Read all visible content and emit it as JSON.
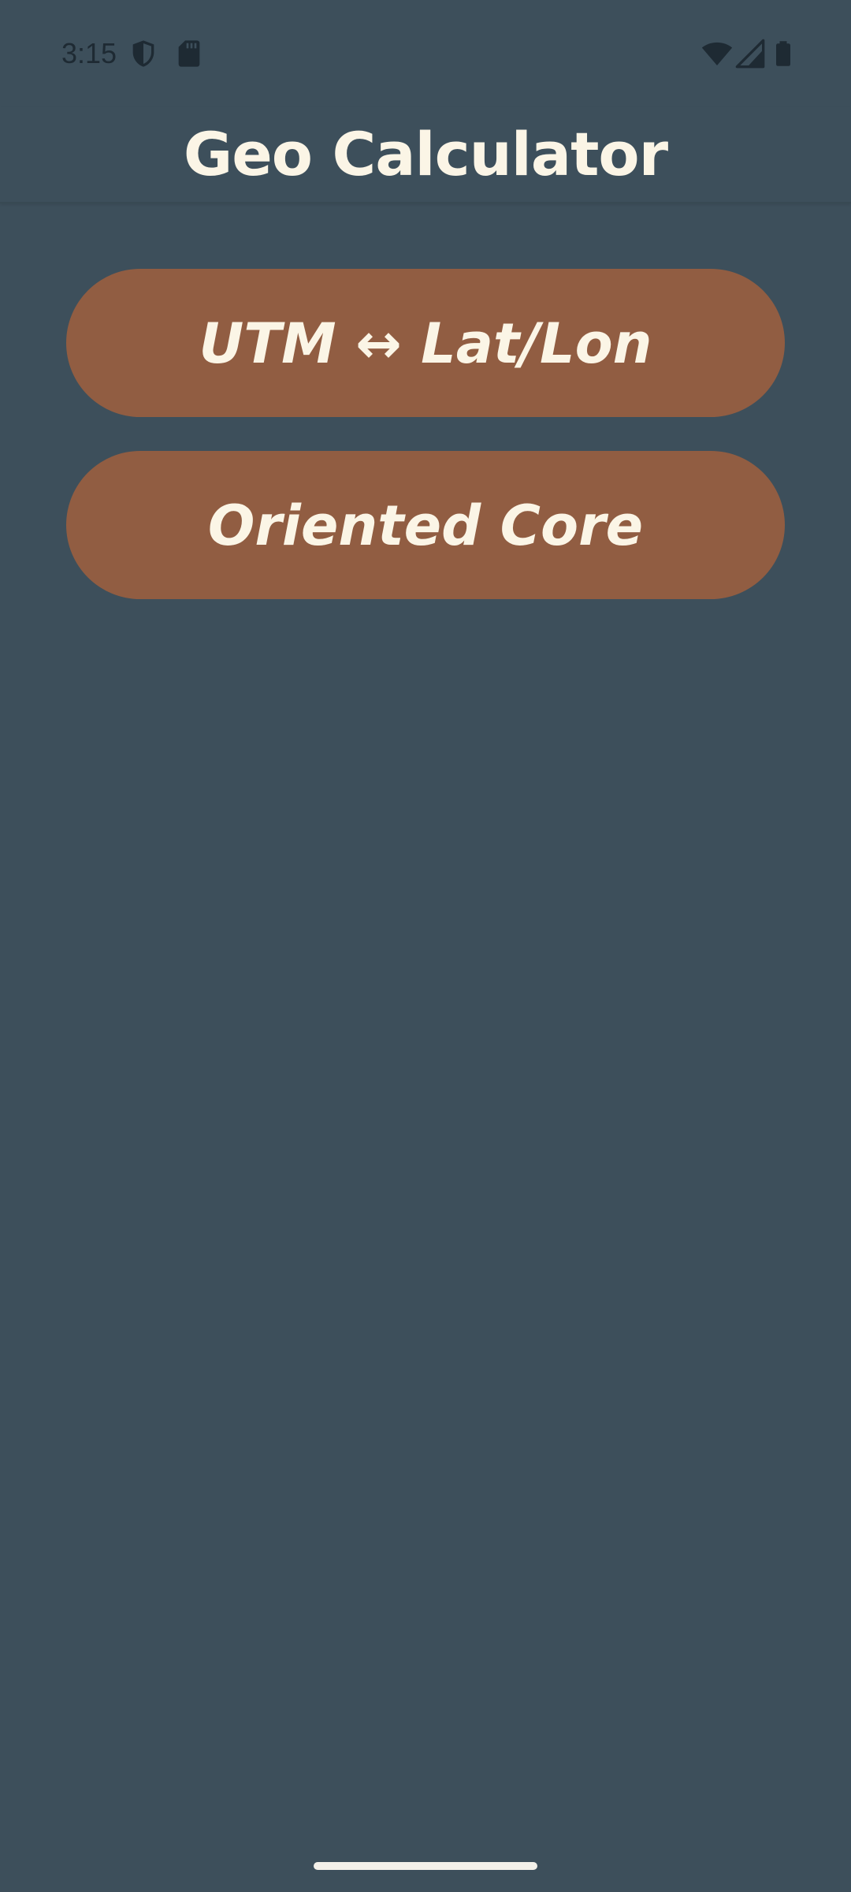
{
  "status_bar": {
    "time": "3:15",
    "icons": [
      "shield-icon",
      "sd-card-icon",
      "wifi-icon",
      "signal-icon",
      "battery-icon"
    ],
    "icon_color": "#1E2A33"
  },
  "app_bar": {
    "title": "Geo Calculator"
  },
  "menu": {
    "buttons": [
      {
        "label": "UTM ↔ Lat/Lon"
      },
      {
        "label": "Oriented Core"
      }
    ]
  },
  "colors": {
    "background": "#3D4F5B",
    "button": "#915D42",
    "text": "#FBF5E6"
  }
}
